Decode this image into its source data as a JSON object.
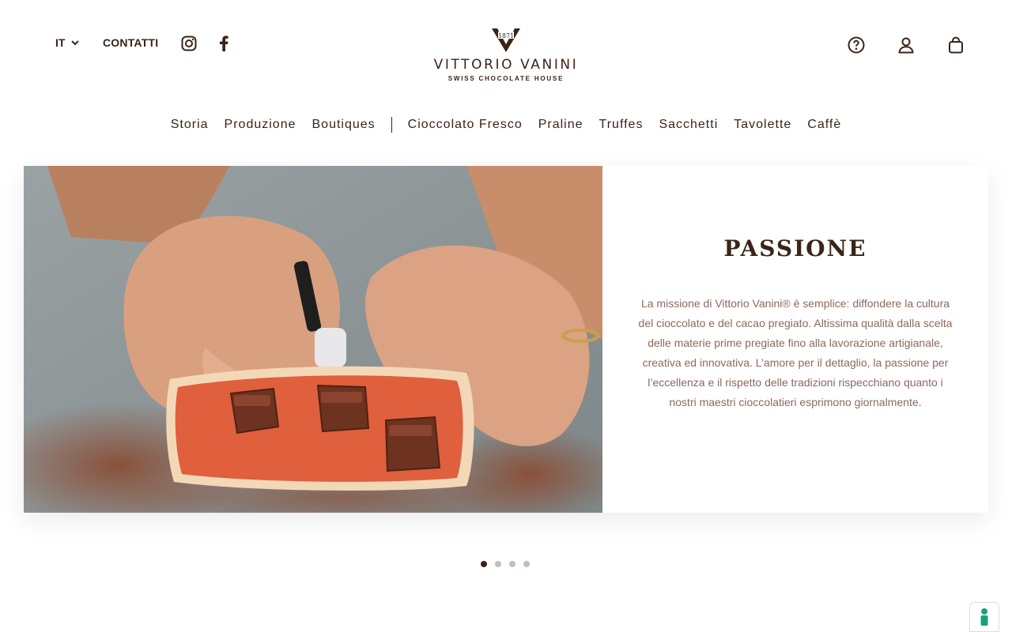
{
  "header": {
    "language": "IT",
    "contact_label": "CONTATTI",
    "social": [
      "instagram-icon",
      "facebook-icon"
    ],
    "icons_right": [
      "help-icon",
      "account-icon",
      "cart-icon"
    ]
  },
  "logo": {
    "year": "1871",
    "name": "VITTORIO VANINI",
    "tagline": "SWISS CHOCOLATE HOUSE"
  },
  "nav": {
    "group1": [
      "Storia",
      "Produzione",
      "Boutiques"
    ],
    "group2": [
      "Cioccolato Fresco",
      "Praline",
      "Truffes",
      "Sacchetti",
      "Tavolette",
      "Caffè"
    ]
  },
  "slide": {
    "title": "PASSIONE",
    "text": "La missione di Vittorio Vanini® è semplice: diffondere la cultura del cioccolato e del cacao pregiato. Altissima qualità dalla scelta delle materie prime pregiate fino alla lavorazione artigianale, creativa ed innovativa. L’amore per il dettaglio, la passione per l’eccellenza e il rispetto delle tradizioni rispecchiano quanto i nostri maestri cioccolatieri esprimono giornalmente."
  },
  "slider": {
    "count": 4,
    "active_index": 0
  },
  "colors": {
    "brand_brown": "#3a2418",
    "text_muted": "#8a6a5c",
    "badge_green": "#1aa37a"
  }
}
